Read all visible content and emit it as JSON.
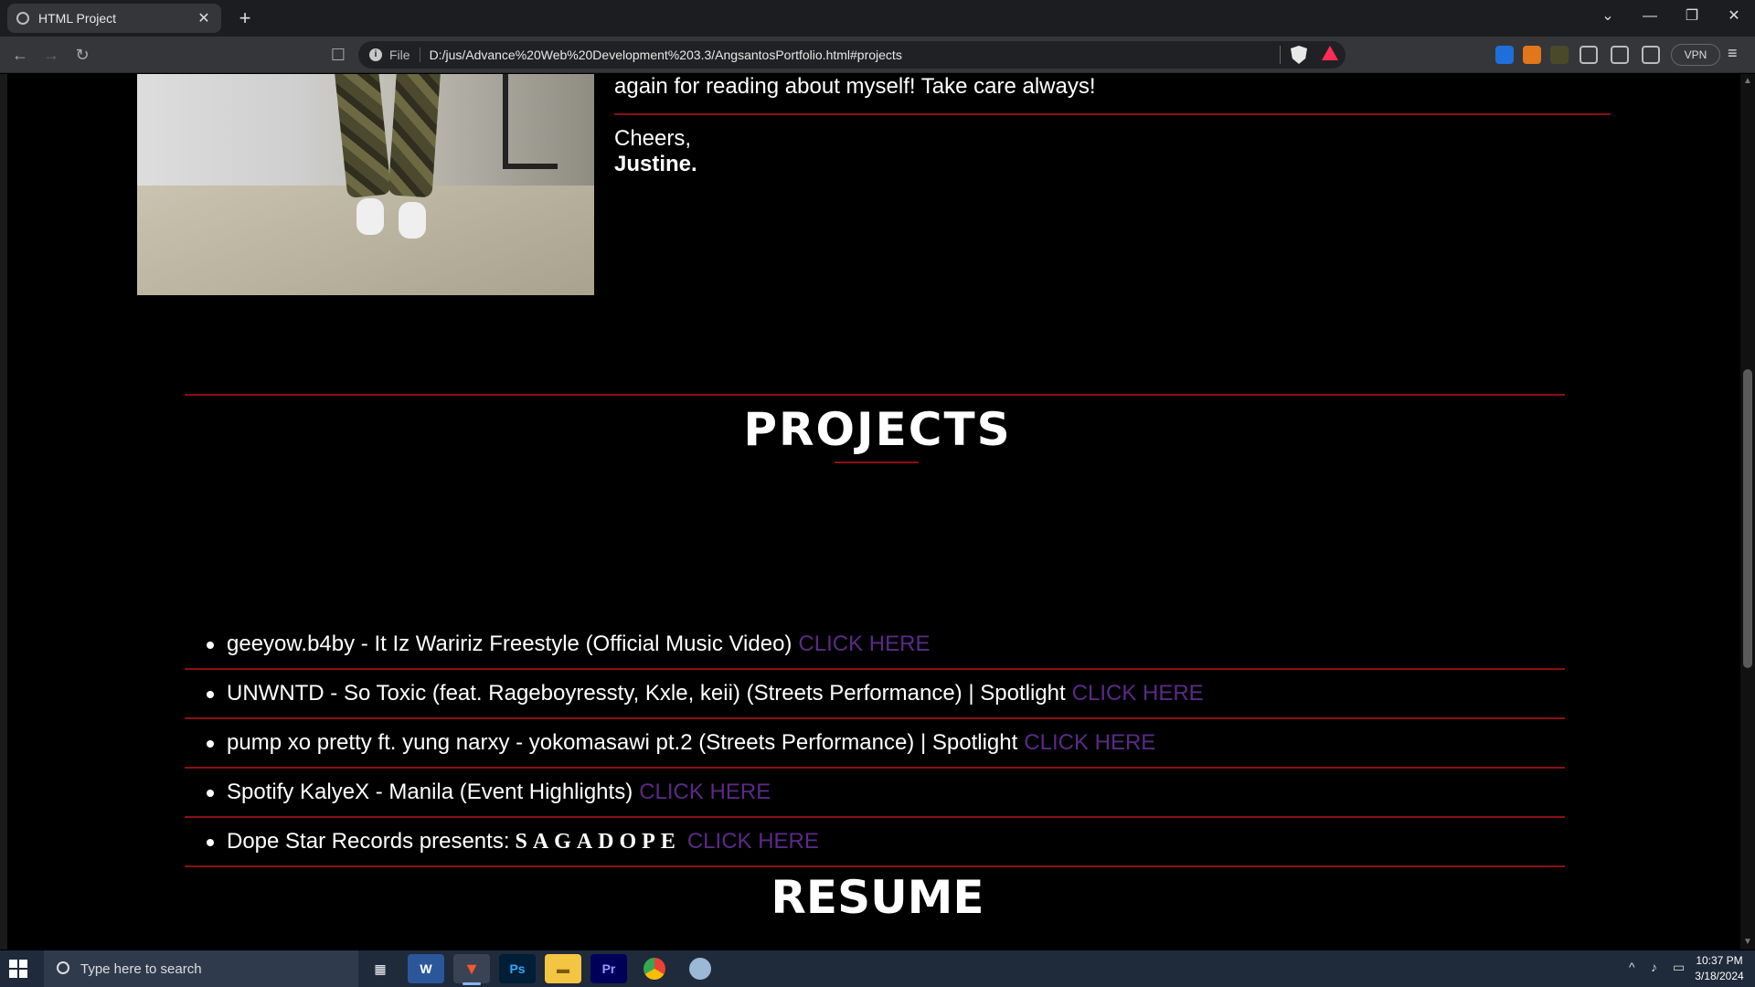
{
  "browser": {
    "tab_title": "HTML Project",
    "tab_close": "✕",
    "new_tab": "+",
    "window": {
      "dropdown": "⌄",
      "minimize": "—",
      "restore": "❐",
      "close": "✕"
    },
    "url_scheme": "File",
    "url": "D:/jus/Advance%20Web%20Development%203.3/AngsantosPortfolio.html#projects",
    "vpn_label": "VPN"
  },
  "about": {
    "text": "again for reading about myself! Take care always!",
    "cheers": "Cheers,",
    "signature": "Justine."
  },
  "projects": {
    "title": "PROJECTS",
    "items": [
      {
        "text": "geeyow.b4by - It Iz Waririz Freestyle (Official Music Video)",
        "link": "CLICK HERE"
      },
      {
        "text": "UNWNTD - So Toxic (feat. Rageboyressty, Kxle, keii) (Streets Performance) | Spotlight",
        "link": "CLICK HERE"
      },
      {
        "text": "pump xo pretty ft. yung narxy - yokomasawi pt.2 (Streets Performance) | Spotlight",
        "link": "CLICK HERE"
      },
      {
        "text": "Spotify KalyeX - Manila (Event Highlights)",
        "link": "CLICK HERE"
      },
      {
        "text": "Dope Star Records presents:",
        "styled": "SAGADOPE",
        "link": "CLICK HERE"
      }
    ],
    "link_color": "#5b2a86",
    "accent_color": "#8b0f14"
  },
  "resume": {
    "title": "RESUME"
  },
  "taskbar": {
    "search_placeholder": "Type here to search",
    "apps": [
      "task-view",
      "word",
      "brave",
      "photoshop",
      "file-explorer",
      "premiere",
      "chrome",
      "other"
    ],
    "time": "10:37 PM",
    "date": "3/18/2024"
  }
}
